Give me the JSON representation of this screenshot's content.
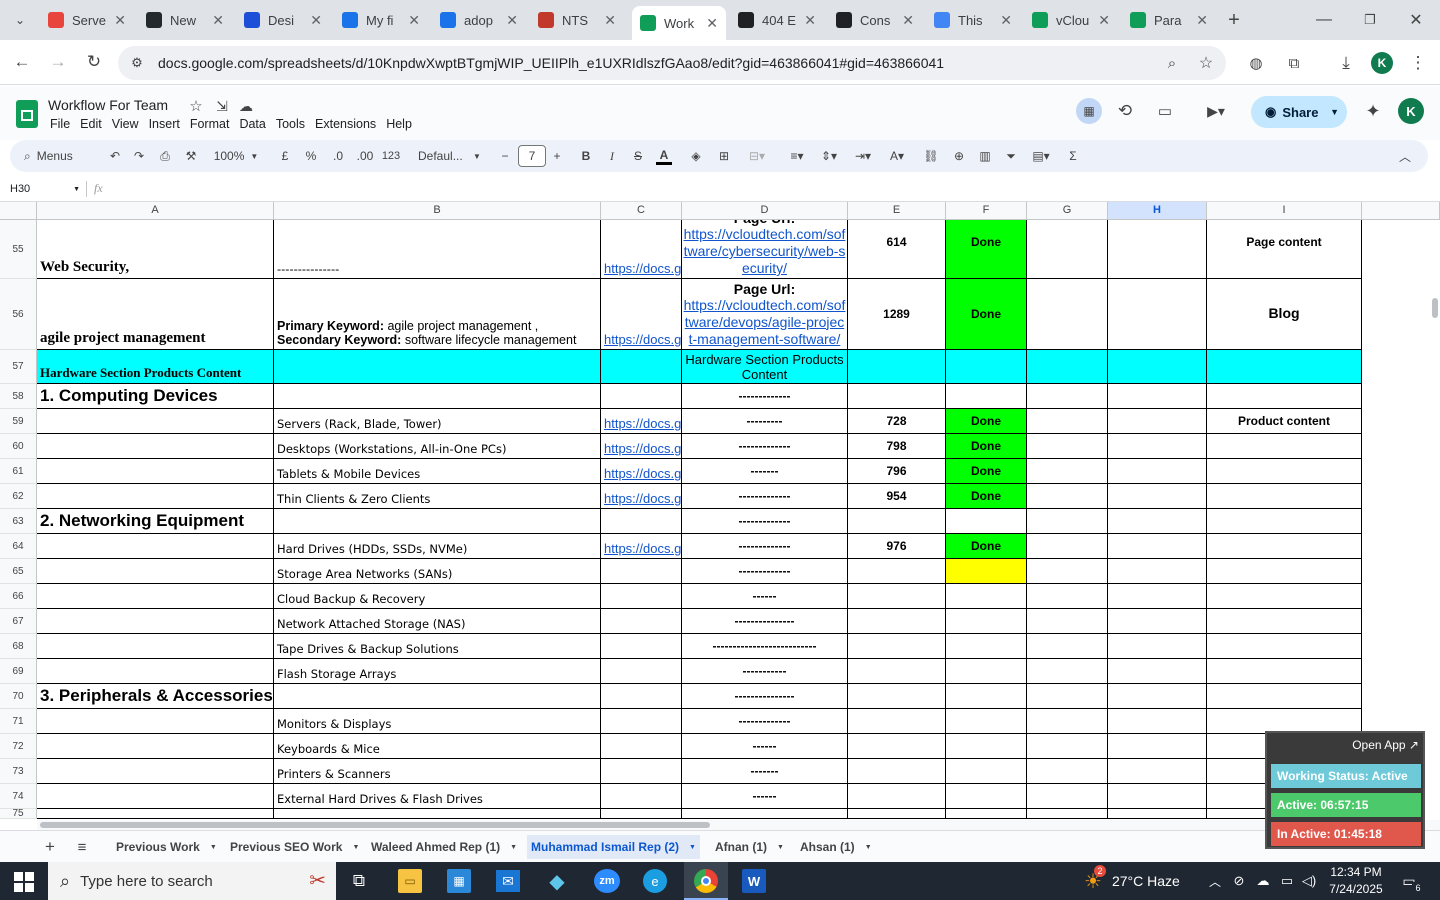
{
  "browser_tabs": [
    {
      "label": "Serve",
      "icon": "red-logo-icon",
      "color": "#e8453c"
    },
    {
      "label": "New",
      "icon": "github-icon",
      "color": "#24292e"
    },
    {
      "label": "Desi",
      "icon": "x-logo-icon",
      "color": "#1d4ed8"
    },
    {
      "label": "My fi",
      "icon": "bookmark-icon",
      "color": "#1a73e8"
    },
    {
      "label": "adop",
      "icon": "diamond-icon",
      "color": "#1a73e8"
    },
    {
      "label": "NTS",
      "icon": "nts-icon",
      "color": "#c0392b"
    },
    {
      "label": "Work",
      "icon": "sheets-icon",
      "color": "#0f9d58",
      "active": true
    },
    {
      "label": "404 E",
      "icon": "wikipedia-icon",
      "color": "#202124"
    },
    {
      "label": "Cons",
      "icon": "cons-icon",
      "color": "#202124"
    },
    {
      "label": "This",
      "icon": "google-icon",
      "color": "#4285f4"
    },
    {
      "label": "vClou",
      "icon": "sheets-icon",
      "color": "#0f9d58"
    },
    {
      "label": "Para",
      "icon": "sheets-icon",
      "color": "#0f9d58"
    }
  ],
  "address": {
    "url": "docs.google.com/spreadsheets/d/10KnpdwXwptBTgmjWIP_UEIIPlh_e1UXRIdlszfGAao8/edit?gid=463866041#gid=463866041"
  },
  "profile_letter": "K",
  "doc": {
    "title": "Workflow For Team",
    "menus": [
      "File",
      "Edit",
      "View",
      "Insert",
      "Format",
      "Data",
      "Tools",
      "Extensions",
      "Help"
    ],
    "share_label": "Share"
  },
  "toolbar": {
    "menus_label": "Menus",
    "zoom": "100%",
    "currency": "£",
    "percent": "%",
    "dec_dec": ".0",
    "dec_inc": ".00",
    "format_123": "123",
    "font": "Defaul...",
    "font_size": "7"
  },
  "formula_bar": {
    "cell_ref": "H30",
    "fx": "fx"
  },
  "columns": [
    "A",
    "B",
    "C",
    "D",
    "E",
    "F",
    "G",
    "H",
    "I"
  ],
  "rows": [
    {
      "num": "55",
      "a": "Web Security,",
      "b": "---------------",
      "c": "https://docs.g",
      "d_head": "Page Url:",
      "d_link": "https://vcloudtech.com/software/cybersecurity/web-security/",
      "e": "614",
      "f": "Done",
      "i": "Page content"
    },
    {
      "num": "56",
      "a": "agile project management",
      "b1_bold": "Primary Keyword:",
      "b1": "  agile project management ,",
      "b2_bold": "Secondary Keyword:",
      "b2": "  software lifecycle management",
      "c": "https://docs.g",
      "d_head": "Page Url:",
      "d_link": "https://vcloudtech.com/software/devops/agile-project-management-software/",
      "e": "1289",
      "f": "Done",
      "i": "Blog"
    },
    {
      "num": "57",
      "a": "Hardware Section Products Content",
      "d": "Hardware Section Products Content"
    },
    {
      "num": "58",
      "a": "1. Computing Devices",
      "d": "-------------"
    },
    {
      "num": "59",
      "b": "Servers (Rack, Blade, Tower)",
      "c": "https://docs.g",
      "d": "---------",
      "e": "728",
      "f": "Done",
      "i": "Product content"
    },
    {
      "num": "60",
      "b": "Desktops (Workstations, All-in-One PCs)",
      "c": "https://docs.g",
      "d": "-------------",
      "e": "798",
      "f": "Done"
    },
    {
      "num": "61",
      "b": "Tablets & Mobile Devices",
      "c": "https://docs.g",
      "d": "-------",
      "e": "796",
      "f": "Done"
    },
    {
      "num": "62",
      "b": "Thin Clients & Zero Clients",
      "c": "https://docs.g",
      "d": "-------------",
      "e": "954",
      "f": "Done"
    },
    {
      "num": "63",
      "a": "2. Networking Equipment",
      "d": "-------------"
    },
    {
      "num": "64",
      "b": "Hard Drives (HDDs, SSDs, NVMe)",
      "c": "https://docs.g",
      "d": "-------------",
      "e": "976",
      "f": "Done"
    },
    {
      "num": "65",
      "b": "Storage Area Networks (SANs)",
      "d": "-------------"
    },
    {
      "num": "66",
      "b": "Cloud Backup & Recovery",
      "d": "------"
    },
    {
      "num": "67",
      "b": "Network Attached Storage (NAS)",
      "d": "---------------"
    },
    {
      "num": "68",
      "b": "Tape Drives & Backup Solutions",
      "d": "--------------------------"
    },
    {
      "num": "69",
      "b": "Flash Storage Arrays",
      "d": "-----------"
    },
    {
      "num": "70",
      "a": "3. Peripherals & Accessories",
      "d": "---------------"
    },
    {
      "num": "71",
      "b": "Monitors & Displays",
      "d": "-------------"
    },
    {
      "num": "72",
      "b": "Keyboards & Mice",
      "d": "------"
    },
    {
      "num": "73",
      "b": "Printers & Scanners",
      "d": "-------"
    },
    {
      "num": "74",
      "b": "External Hard Drives & Flash Drives",
      "d": "------"
    },
    {
      "num": "75"
    }
  ],
  "sheet_tabs": [
    "Previous Work",
    "Previous SEO Work",
    "Waleed Ahmed Rep (1)",
    "Muhammad Ismail Rep (2)",
    "Afnan (1)",
    "Ahsan (1)"
  ],
  "active_sheet": "Muhammad Ismail Rep (2)",
  "work_panel": {
    "open_app": "Open App ↗",
    "status": "Working Status: Active",
    "active": "Active: 06:57:15",
    "inactive": "In Active: 01:45:18"
  },
  "taskbar": {
    "search_placeholder": "Type here to search",
    "weather": "27°C  Haze",
    "weather_badge": "2",
    "time": "12:34 PM",
    "date": "7/24/2025",
    "notif_count": "6"
  },
  "colors": {
    "cyan": "#00ffff",
    "done_green": "#00ff00",
    "pending_yellow": "#ffff00",
    "link": "#1155cc",
    "active_sheet": "#0b57d0"
  }
}
